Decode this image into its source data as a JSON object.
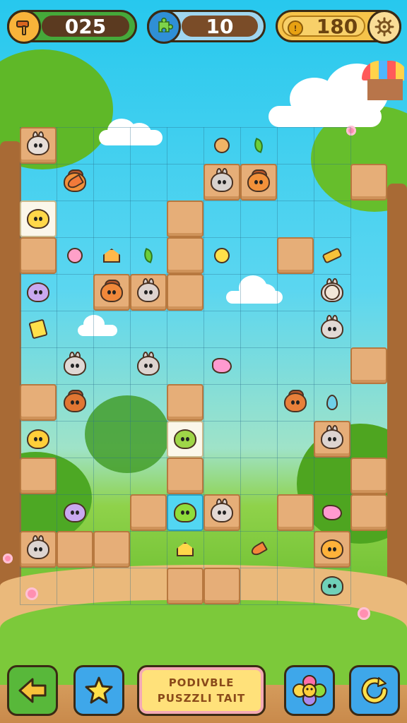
{
  "hud": {
    "score": "025",
    "moves": "10",
    "coins": "180"
  },
  "bottom_bar": {
    "banner_line1": "PODIVBLE",
    "banner_line2": "PUSZZLI TAIT"
  },
  "colors": {
    "sky": "#27c8ee",
    "grass": "#6fc032",
    "dirt_tile": "#e6ae78",
    "hud_wood": "#5b3a20",
    "accent_yellow": "#f7c23a",
    "button_blue": "#3ea7ea",
    "button_green": "#58b83a"
  },
  "icons": {
    "score": "hammer-icon",
    "moves": "puzzle-piece-icon",
    "coins": "coin-icon",
    "settings": "gear-icon",
    "back": "arrow-left-icon",
    "star": "star-icon",
    "hint": "flower-character-icon",
    "reset": "refresh-icon"
  },
  "board": {
    "columns": 9,
    "rows": 13,
    "creatures": [
      {
        "kind": "bunny",
        "color": "#e7ded8",
        "tile": "dirt"
      },
      {
        "kind": "fox",
        "color": "#f2913a",
        "tile": "none"
      },
      {
        "kind": "bird",
        "color": "#ffd84a",
        "tile": "white"
      },
      {
        "kind": "bunny",
        "color": "#d8d2ce",
        "tile": "dirt"
      },
      {
        "kind": "fox",
        "color": "#f2913a",
        "tile": "dirt"
      },
      {
        "kind": "bird",
        "color": "#c9a9f0",
        "tile": "none"
      },
      {
        "kind": "fox",
        "color": "#f0883a",
        "tile": "dirt"
      },
      {
        "kind": "bunny",
        "color": "#ddd3cf",
        "tile": "dirt"
      },
      {
        "kind": "bunny",
        "color": "#e1dad5",
        "tile": "none"
      },
      {
        "kind": "bunny",
        "color": "#e0d8d4",
        "tile": "none"
      },
      {
        "kind": "fox",
        "color": "#e07632",
        "tile": "none"
      },
      {
        "kind": "bunny",
        "color": "#ddd4d0",
        "tile": "none"
      },
      {
        "kind": "fox",
        "color": "#e8803a",
        "tile": "none"
      },
      {
        "kind": "bird",
        "color": "#ffcf3a",
        "tile": "none"
      },
      {
        "kind": "bird",
        "color": "#9fd648",
        "tile": "white"
      },
      {
        "kind": "bunny",
        "color": "#e3d9d4",
        "tile": "none"
      },
      {
        "kind": "bird",
        "color": "#c9a9f0",
        "tile": "none"
      },
      {
        "kind": "slime",
        "color": "#8fdc3a",
        "tile": "cyan"
      },
      {
        "kind": "bunny",
        "color": "#e3d9d4",
        "tile": "dirt"
      },
      {
        "kind": "bunny",
        "color": "#ddd4d0",
        "tile": "dirt"
      },
      {
        "kind": "bird",
        "color": "#ffb23a",
        "tile": "dirt"
      },
      {
        "kind": "bunny",
        "color": "#ddd4d0",
        "tile": "dirt"
      },
      {
        "kind": "slime",
        "color": "#6fd0b8",
        "tile": "none"
      }
    ],
    "items": [
      {
        "kind": "cookie",
        "color": "#f0b466"
      },
      {
        "kind": "leaf",
        "color": "#6ccf3a"
      },
      {
        "kind": "candy",
        "color": "#ffe04a"
      },
      {
        "kind": "carrot",
        "color": "#f27a3a"
      },
      {
        "kind": "house",
        "color": "#ffb84a"
      },
      {
        "kind": "leaf",
        "color": "#6ccf3a"
      },
      {
        "kind": "flower",
        "color": "#ffa0c8"
      },
      {
        "kind": "crystal",
        "color": "#ff9ad0"
      },
      {
        "kind": "crystal",
        "color": "#ff9ad0"
      },
      {
        "kind": "carrot",
        "color": "#f4853a"
      },
      {
        "kind": "house",
        "color": "#ffd74a"
      },
      {
        "kind": "hammer",
        "color": "#f7c23a"
      },
      {
        "kind": "drop",
        "color": "#6fd0e8"
      },
      {
        "kind": "shell",
        "color": "#f2e6d8"
      },
      {
        "kind": "note",
        "color": "#ffe04a"
      }
    ]
  }
}
